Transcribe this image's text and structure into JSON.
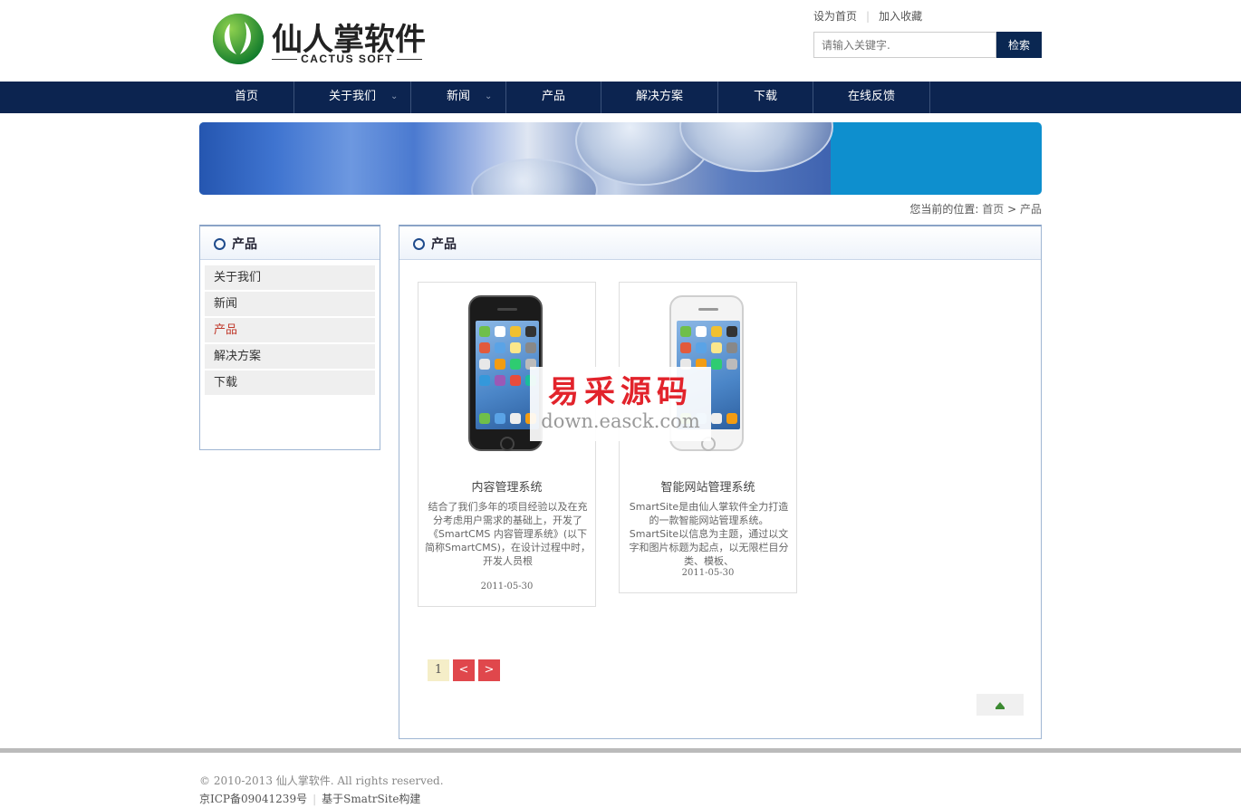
{
  "header": {
    "logo_cn": "仙人掌软件",
    "logo_en": "CACTUS SOFT",
    "top_links": [
      "设为首页",
      "加入收藏"
    ],
    "search": {
      "placeholder": "请输入关键字.",
      "button": "检索"
    }
  },
  "nav": {
    "items": [
      {
        "label": "首页",
        "has_dropdown": false
      },
      {
        "label": "关于我们",
        "has_dropdown": true
      },
      {
        "label": "新闻",
        "has_dropdown": true
      },
      {
        "label": "产品",
        "has_dropdown": false
      },
      {
        "label": "解决方案",
        "has_dropdown": false
      },
      {
        "label": "下载",
        "has_dropdown": false
      },
      {
        "label": "在线反馈",
        "has_dropdown": false
      }
    ]
  },
  "breadcrumb": {
    "prefix": "您当前的位置:",
    "home": "首页",
    "sep": ">",
    "current": "产品"
  },
  "sidebar": {
    "title": "产品",
    "items": [
      {
        "label": "关于我们",
        "active": false
      },
      {
        "label": "新闻",
        "active": false
      },
      {
        "label": "产品",
        "active": true
      },
      {
        "label": "解决方案",
        "active": false
      },
      {
        "label": "下载",
        "active": false
      }
    ]
  },
  "main": {
    "title": "产品",
    "products": [
      {
        "name": "内容管理系统",
        "description": "结合了我们多年的项目经验以及在充分考虑用户需求的基础上，开发了《SmartCMS 内容管理系统》(以下简称SmartCMS)，在设计过程中时，开发人员根",
        "date": "2011-05-30",
        "phone_color": "black"
      },
      {
        "name": "智能网站管理系统",
        "description": "SmartSite是由仙人掌软件全力打造的一款智能网站管理系统。SmartSite以信息为主题，通过以文字和图片标题为起点，以无限栏目分类、模板、",
        "date": "2011-05-30",
        "phone_color": "white"
      }
    ],
    "pager": {
      "current": "1",
      "prev": "<",
      "next": ">"
    }
  },
  "watermark": {
    "cn": "易采源码",
    "en": "down.easck.com"
  },
  "footer": {
    "copyright": "© 2010-2013 仙人掌软件. All rights reserved.",
    "icp": "京ICP备09041239号",
    "powered": "基于SmatrSite构建"
  },
  "colors": {
    "nav_bg": "#0c2450",
    "search_button": "#0a2752",
    "active_sidebar": "#c0392b",
    "pager_nav": "#e0474c",
    "banner_blue": "#0e8fce"
  }
}
